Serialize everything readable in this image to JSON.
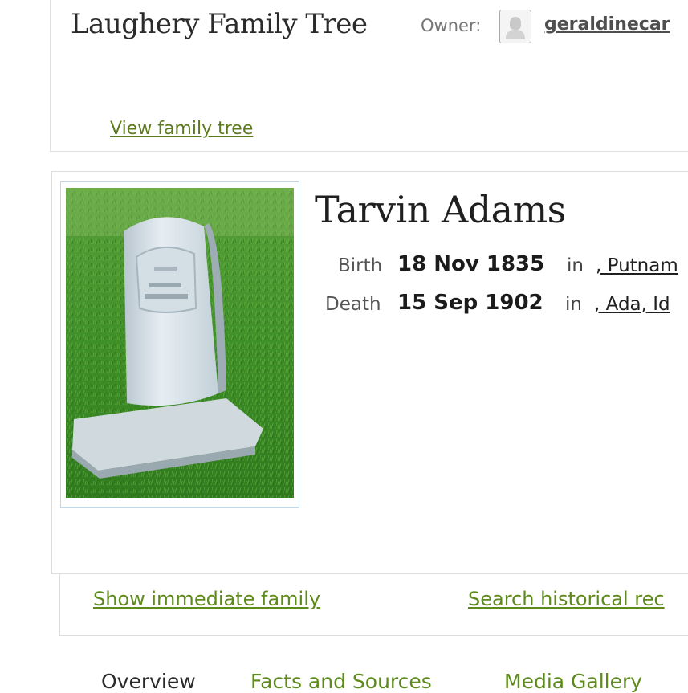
{
  "header": {
    "tree_title": "Laughery Family Tree",
    "owner_label": "Owner:",
    "owner_name": "geraldinecar",
    "view_tree_link": "View family tree"
  },
  "person": {
    "name": "Tarvin Adams",
    "birth": {
      "label": "Birth",
      "date": "18 Nov 1835",
      "in": "in",
      "place": ", Putnam"
    },
    "death": {
      "label": "Death",
      "date": "15 Sep 1902",
      "in": "in",
      "place": ", Ada, Id"
    }
  },
  "links": {
    "immediate_family": "Show immediate family",
    "historical_records": "Search historical rec"
  },
  "tabs": [
    {
      "label": "Overview",
      "active": true
    },
    {
      "label": "Facts and Sources",
      "active": false
    },
    {
      "label": "Media Gallery",
      "active": false
    }
  ],
  "colors": {
    "link_green": "#5d8a1a",
    "title_text": "#2b2b2b",
    "border": "#dcdcdc"
  },
  "icons": {
    "owner_avatar": "person-silhouette-icon"
  }
}
